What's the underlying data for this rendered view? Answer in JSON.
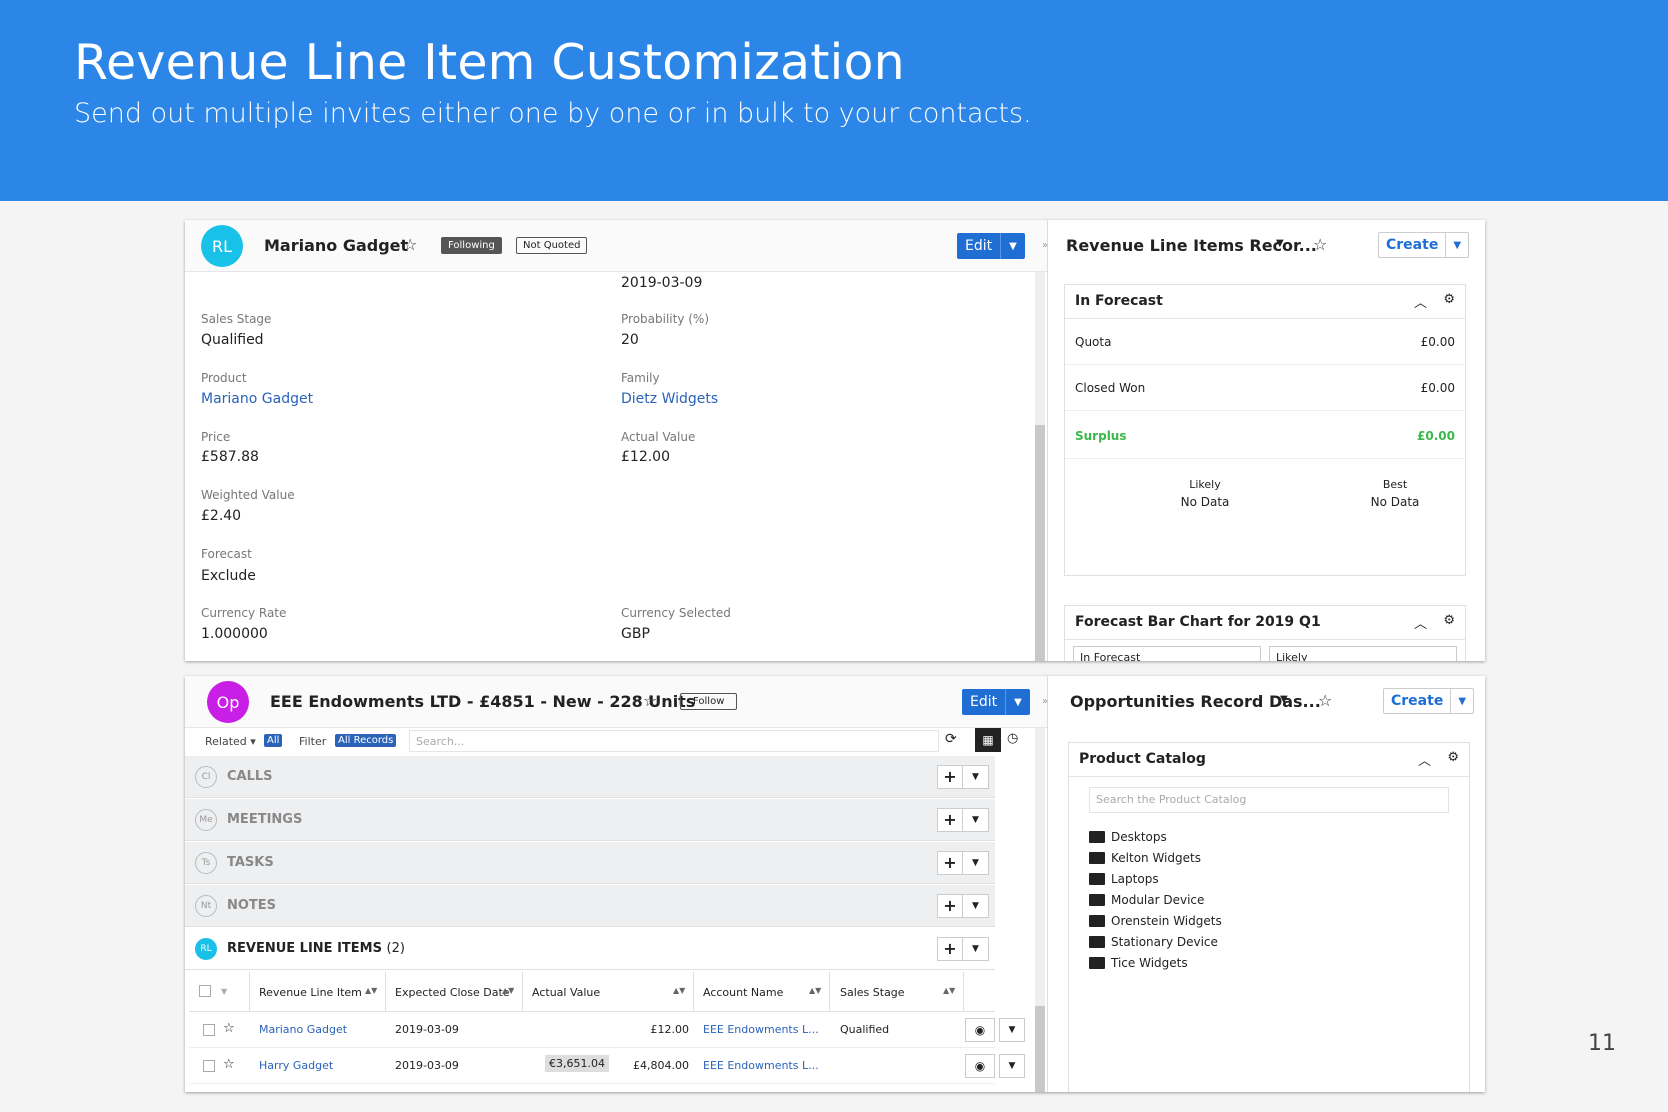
{
  "banner": {
    "title": "Revenue Line Item Customization",
    "subtitle": "Send out multiple invites either one by one or in bulk to your contacts."
  },
  "page_number": "11",
  "record1": {
    "avatar": "RL",
    "avatar_color": "#18c1e8",
    "title": "Mariano Gadget",
    "following": "Following",
    "status": "Not Quoted",
    "edit": "Edit",
    "top_value": "2019-03-09",
    "fields": {
      "sales_stage_label": "Sales Stage",
      "sales_stage": "Qualified",
      "probability_label": "Probability (%)",
      "probability": "20",
      "product_label": "Product",
      "product": "Mariano Gadget",
      "family_label": "Family",
      "family": "Dietz Widgets",
      "price_label": "Price",
      "price": "£587.88",
      "actual_label": "Actual Value",
      "actual": "£12.00",
      "weighted_label": "Weighted Value",
      "weighted": "£2.40",
      "forecast_label": "Forecast",
      "forecast": "Exclude",
      "rate_label": "Currency Rate",
      "rate": "1.000000",
      "currency_label": "Currency Selected",
      "currency": "GBP"
    }
  },
  "dash1": {
    "title": "Revenue Line Items Recor...",
    "create": "Create",
    "forecast": {
      "title": "In Forecast",
      "rows": [
        {
          "k": "Quota",
          "v": "£0.00"
        },
        {
          "k": "Closed Won",
          "v": "£0.00"
        },
        {
          "k": "Surplus",
          "v": "£0.00"
        }
      ],
      "likely_label": "Likely",
      "likely": "No Data",
      "best_label": "Best",
      "best": "No Data"
    },
    "chart_title": "Forecast Bar Chart for 2019 Q1",
    "select1": "In Forecast",
    "select2": "Likely"
  },
  "record2": {
    "avatar": "Op",
    "avatar_color": "#c81ee6",
    "title": "EEE Endowments LTD - £4851 - New - 228 Units",
    "follow": "Follow",
    "edit": "Edit",
    "related": "Related",
    "all": "All",
    "filter": "Filter",
    "all_records": "All Records",
    "search_placeholder": "Search...",
    "sections": [
      {
        "abbr": "Cl",
        "name": "CALLS"
      },
      {
        "abbr": "Me",
        "name": "MEETINGS"
      },
      {
        "abbr": "Ts",
        "name": "TASKS"
      },
      {
        "abbr": "Nt",
        "name": "NOTES"
      }
    ],
    "rli_section": {
      "abbr": "RL",
      "name": "REVENUE LINE ITEMS",
      "count": "(2)"
    },
    "table": {
      "headers": [
        "Revenue Line Item",
        "Expected Close Date",
        "Actual Value",
        "Account Name",
        "Sales Stage"
      ],
      "rows": [
        {
          "item": "Mariano Gadget",
          "date": "2019-03-09",
          "converted": "",
          "value": "£12.00",
          "account": "EEE Endowments L...",
          "stage": "Qualified"
        },
        {
          "item": "Harry Gadget",
          "date": "2019-03-09",
          "converted": "€3,651.04",
          "value": "£4,804.00",
          "account": "EEE Endowments L...",
          "stage": ""
        }
      ]
    }
  },
  "dash2": {
    "title": "Opportunities Record Das...",
    "create": "Create",
    "catalog_title": "Product Catalog",
    "catalog_search": "Search the Product Catalog",
    "folders": [
      "Desktops",
      "Kelton Widgets",
      "Laptops",
      "Modular Device",
      "Orenstein Widgets",
      "Stationary Device",
      "Tice Widgets"
    ]
  }
}
